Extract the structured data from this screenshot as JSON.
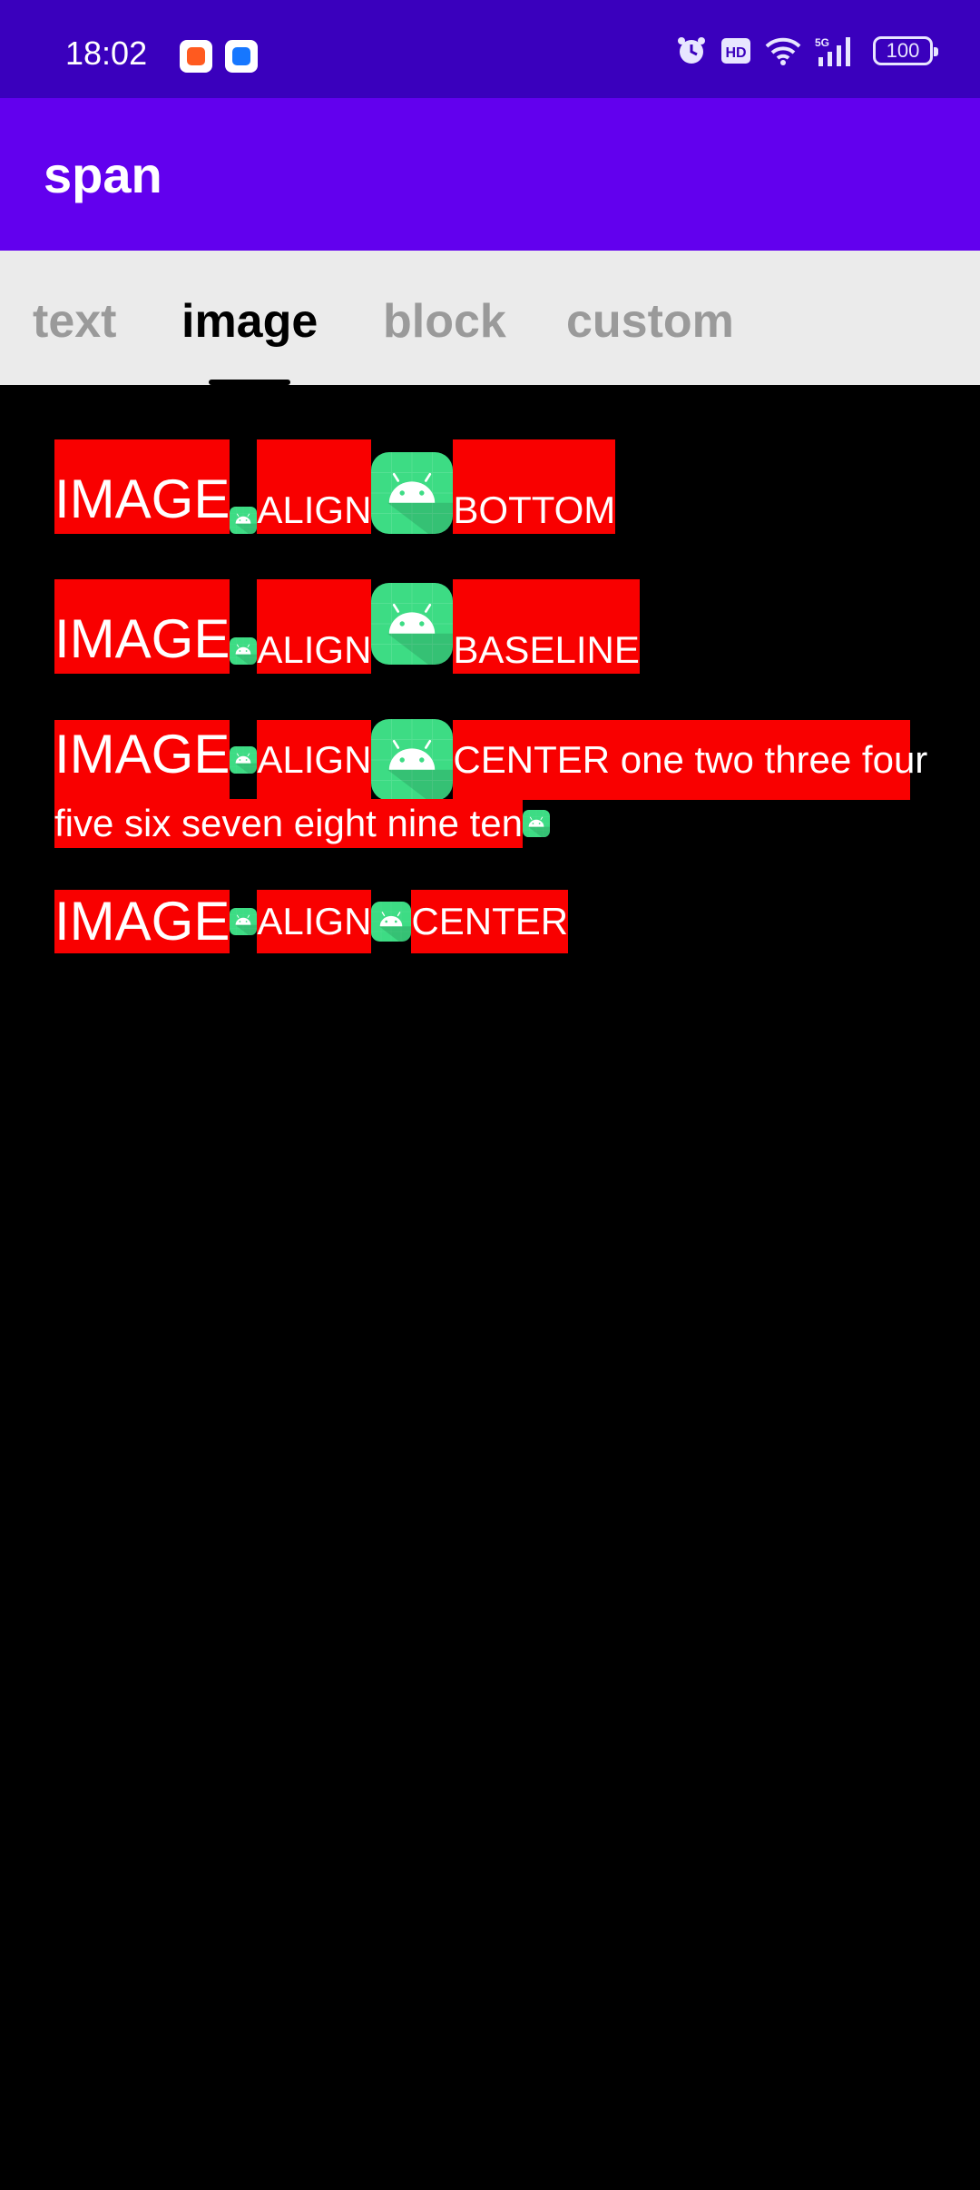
{
  "status_bar": {
    "time": "18:02",
    "battery": "100",
    "network": "5G",
    "hd_label": "HD"
  },
  "app_bar": {
    "title": "span"
  },
  "tabs": [
    {
      "label": "text",
      "selected": false
    },
    {
      "label": "image",
      "selected": true
    },
    {
      "label": "block",
      "selected": false
    },
    {
      "label": "custom",
      "selected": false
    }
  ],
  "rows": [
    {
      "image_word": "IMAGE",
      "align_word": "ALIGN",
      "mode": "BOTTOM"
    },
    {
      "image_word": "IMAGE",
      "align_word": "ALIGN",
      "mode": "BASELINE"
    },
    {
      "image_word": "IMAGE",
      "align_word": "ALIGN",
      "mode": "CENTER one two three four",
      "continuation": "five six seven eight nine ten"
    },
    {
      "image_word": "IMAGE",
      "align_word": "ALIGN",
      "mode": "CENTER"
    }
  ],
  "colors": {
    "status_bar": "#3a00bd",
    "app_bar": "#6200ee",
    "tab_bar": "#ebebeb",
    "span_background": "#f90000",
    "android_icon": "#3ddc84"
  },
  "icons": [
    "alarm-icon",
    "hd-icon",
    "wifi-icon",
    "cellular-signal-icon",
    "battery-icon",
    "android-icon"
  ]
}
